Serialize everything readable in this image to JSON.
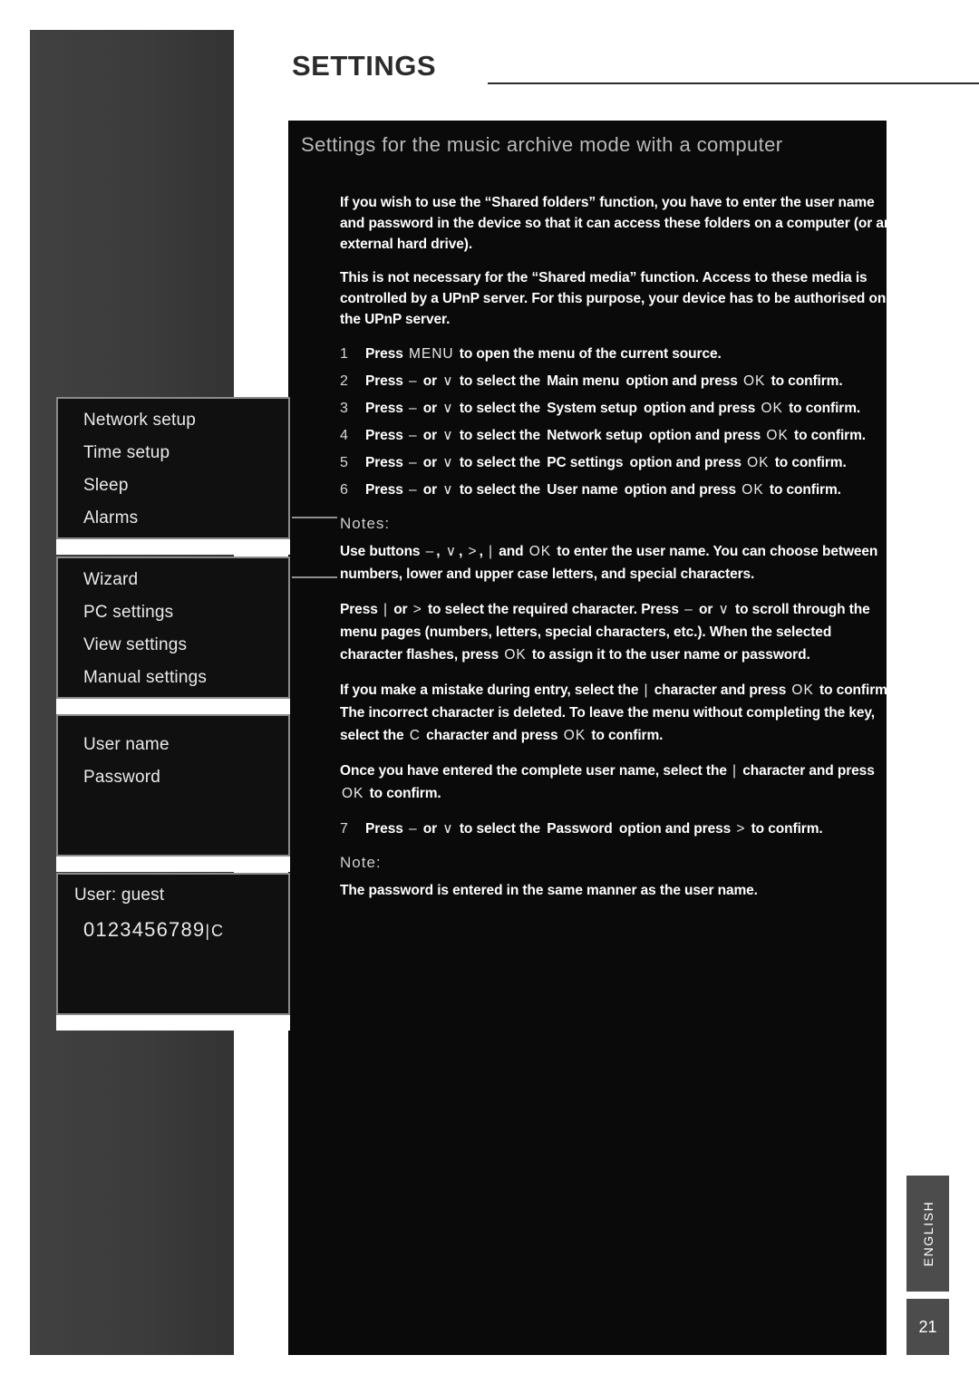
{
  "header": {
    "title": "SETTINGS"
  },
  "section": {
    "title": "Settings for the music archive mode with a computer"
  },
  "paragraphs": [
    "If you wish to use the “Shared folders” function, you have to enter the user name and password in the device so that it can access these folders on a computer (or an external hard drive).",
    "This is not necessary for the “Shared media” function. Access to these media is controlled by a UPnP server. For this purpose, your device has to be authorised on the UPnP server."
  ],
  "steps": [
    {
      "num": "1",
      "html": "Press <span class=\"key\">MENU</span> to open the menu of the current source."
    },
    {
      "num": "2",
      "html": "Press <span class=\"key\">–</span> or <span class=\"key\">∨</span> to select the <span class=\"kw\">Main menu</span> option and press <span class=\"key\">OK</span> to confirm."
    },
    {
      "num": "3",
      "html": "Press <span class=\"key\">–</span> or <span class=\"key\">∨</span> to select the <span class=\"kw\">System setup</span> option and press <span class=\"key\">OK</span> to confirm."
    },
    {
      "num": "4",
      "html": "Press <span class=\"key\">–</span> or <span class=\"key\">∨</span> to select the <span class=\"kw\">Network setup</span> option and press <span class=\"key\">OK</span> to confirm."
    },
    {
      "num": "5",
      "html": "Press <span class=\"key\">–</span> or <span class=\"key\">∨</span> to select the <span class=\"kw\">PC settings</span> option and press <span class=\"key\">OK</span> to confirm."
    },
    {
      "num": "6",
      "html": "Press <span class=\"key\">–</span> or <span class=\"key\">∨</span> to select the <span class=\"kw\">User name</span> option and press <span class=\"key\">OK</span> to confirm."
    }
  ],
  "notes": {
    "label": "Notes:",
    "items": [
      "Use buttons <span class=\"key\">–</span>, <span class=\"key\">∨</span>, <span class=\"key\">&gt;</span>, <span class=\"key\">|</span> and <span class=\"key\">OK</span> to enter the user name. You can choose between numbers, lower and upper case letters, and special characters.",
      "Press <span class=\"key\">|</span> or <span class=\"key\">&gt;</span> to select the required character. Press <span class=\"key\">–</span> or <span class=\"key\">∨</span> to scroll through the menu pages (numbers, letters, special characters, etc.). When the selected character flashes, press <span class=\"key\">OK</span> to assign it to the user name or password.",
      "If you make a mistake during entry, select the <span class=\"key\">|</span> character and press <span class=\"key\">OK</span> to confirm. The incorrect character is deleted. To leave the menu without completing the key, select the <span class=\"key\">C</span> character and press <span class=\"key\">OK</span> to confirm.",
      "Once you have entered the complete user name, select the <span class=\"key\">|</span> character and press <span class=\"key\">OK</span> to confirm."
    ]
  },
  "step7": {
    "num": "7",
    "html": "Press <span class=\"key\">–</span> or <span class=\"key\">∨</span> to select the <span class=\"kw\">Password</span> option and press <span class=\"key\">&gt;</span> to confirm."
  },
  "note_single": {
    "label": "Note:",
    "text": "The password is entered in the same manner as the user name."
  },
  "displays": [
    {
      "name": "display-menu-1",
      "rows": [
        "Network setup",
        "Time setup",
        "Sleep",
        "Alarms"
      ]
    },
    {
      "name": "display-menu-2",
      "rows": [
        "Wizard",
        "PC settings",
        "View settings",
        "Manual settings"
      ]
    },
    {
      "name": "display-menu-3",
      "rows": [
        "User name",
        "Password"
      ]
    }
  ],
  "display4": {
    "user_line": "User: guest",
    "chars": "0123456789",
    "trail": "|C"
  },
  "sidebar": {
    "language": "ENGLISH",
    "page_number": "21"
  }
}
